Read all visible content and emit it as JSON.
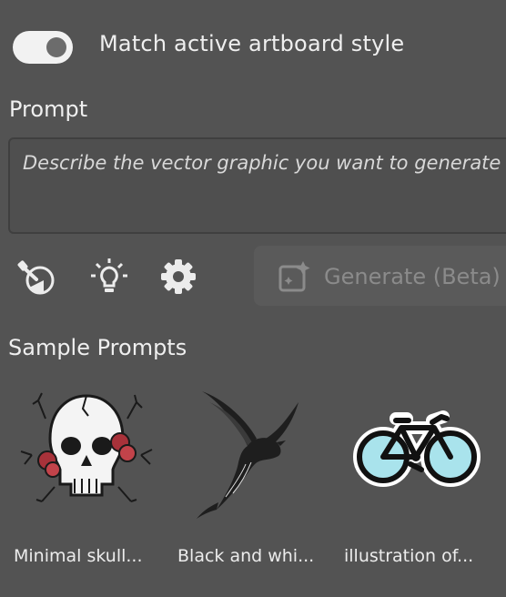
{
  "toggle": {
    "state": "on",
    "label": "Match active artboard style"
  },
  "prompt": {
    "label": "Prompt",
    "placeholder": "Describe the vector graphic you want to generate"
  },
  "toolbar": {
    "icons": [
      "style-picker-icon",
      "lightbulb-icon",
      "gear-icon"
    ],
    "generate_label": "Generate (Beta)"
  },
  "samples": {
    "label": "Sample Prompts",
    "items": [
      {
        "caption": "Minimal skull...",
        "image": "skull-with-roses"
      },
      {
        "caption": "Black and whi...",
        "image": "flying-bird"
      },
      {
        "caption": "illustration of...",
        "image": "bicycle"
      }
    ]
  },
  "colors": {
    "background": "#535353",
    "toggle_on": "#f2f2f2",
    "bike_fill": "#a9e3ec"
  }
}
